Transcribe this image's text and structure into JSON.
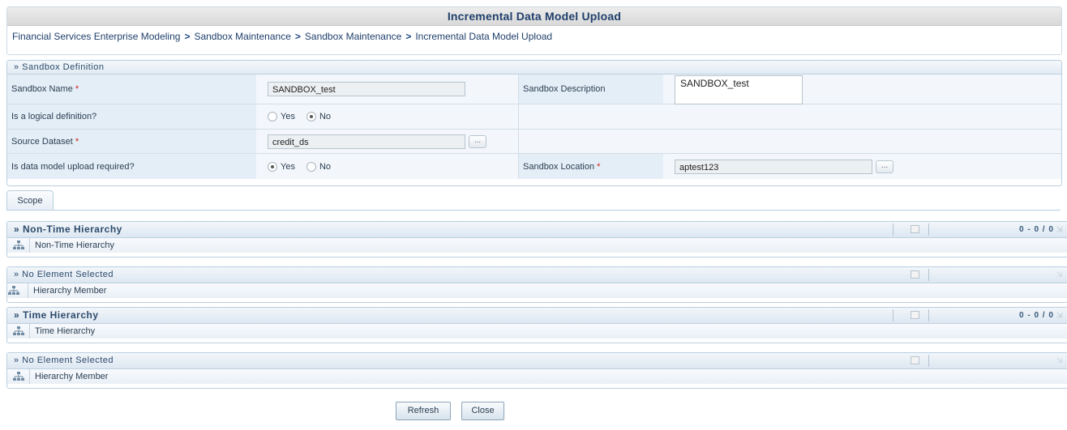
{
  "page": {
    "title": "Incremental Data Model Upload",
    "breadcrumb": [
      "Financial Services Enterprise Modeling",
      "Sandbox Maintenance",
      "Sandbox Maintenance",
      "Incremental Data Model Upload"
    ],
    "breadcrumb_sep": ">"
  },
  "definition": {
    "header": "» Sandbox Definition",
    "sandbox_name_label": "Sandbox Name",
    "sandbox_name_value": "SANDBOX_test",
    "sandbox_desc_label": "Sandbox Description",
    "sandbox_desc_value": "SANDBOX_test",
    "logical_label": "Is a logical definition?",
    "logical_options": [
      "Yes",
      "No"
    ],
    "logical_selected": "No",
    "source_label": "Source Dataset",
    "source_value": "credit_ds",
    "upload_label": "Is data model upload required?",
    "upload_options": [
      "Yes",
      "No"
    ],
    "upload_selected": "Yes",
    "location_label": "Sandbox Location",
    "location_value": "aptest123",
    "required_mark": "*",
    "browse_label": "..."
  },
  "tabs": {
    "scope": "Scope"
  },
  "panels": [
    {
      "header": "» Non-Time Hierarchy",
      "bold": true,
      "pager": "0 - 0 / 0",
      "row": "Non-Time Hierarchy"
    },
    {
      "header": "» No Element Selected",
      "bold": false,
      "pager": "",
      "row": "Hierarchy Member"
    },
    {
      "header": "» Time Hierarchy",
      "bold": true,
      "pager": "0 - 0 / 0",
      "row": "Time Hierarchy"
    },
    {
      "header": "» No Element Selected",
      "bold": false,
      "pager": "",
      "row": "Hierarchy Member"
    }
  ],
  "buttons": {
    "refresh": "Refresh",
    "close": "Close"
  },
  "colors": {
    "title_text": "#1f3f6b",
    "label_bg": "#e4eef7",
    "required": "#d0201c",
    "panel_header": "#dde7f1"
  }
}
